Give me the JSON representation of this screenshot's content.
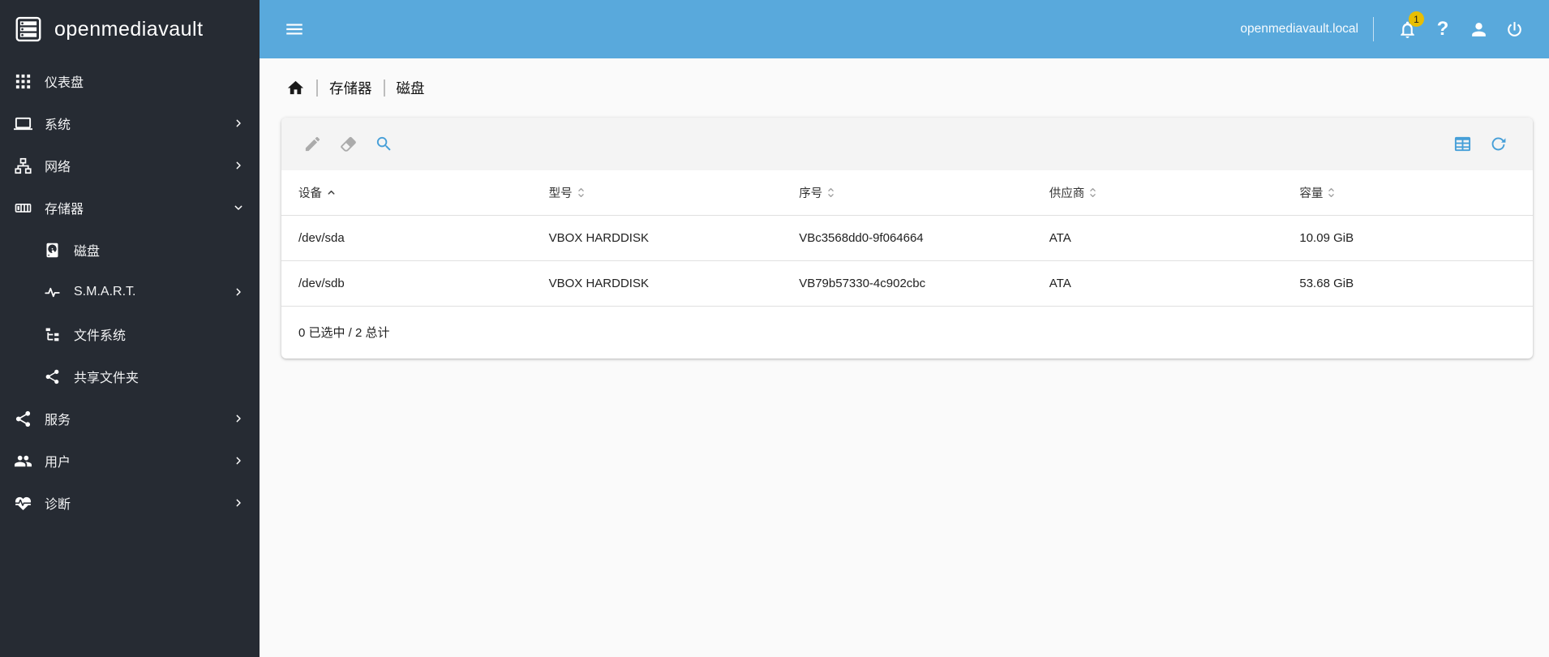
{
  "app": {
    "logo_text": "openmediavault"
  },
  "colors": {
    "header_blue": "#59A9DC",
    "sidebar_bg": "#262B33",
    "accent": "#469FD8",
    "page_bg": "#FAFAFA",
    "card_bg": "#FFFFFF",
    "toolbar_bg": "#F4F4F4",
    "border": "#E0E0E0",
    "text_dark": "#212121",
    "badge_yellow": "#E8BE03",
    "icon_disabled": "#ABABAB"
  },
  "topbar": {
    "hostname": "openmediavault.local",
    "notification_count": "1"
  },
  "sidebar": {
    "items": [
      {
        "id": "dashboard",
        "label": "仪表盘",
        "icon": "dashboard",
        "chevron": null,
        "indent": false
      },
      {
        "id": "system",
        "label": "系统",
        "icon": "laptop",
        "chevron": "right",
        "indent": false
      },
      {
        "id": "network",
        "label": "网络",
        "icon": "lan",
        "chevron": "right",
        "indent": false
      },
      {
        "id": "storage",
        "label": "存储器",
        "icon": "storage",
        "chevron": "down",
        "indent": false
      },
      {
        "id": "disks",
        "label": "磁盘",
        "icon": "harddisk",
        "chevron": null,
        "indent": true
      },
      {
        "id": "smart",
        "label": "S.M.A.R.T.",
        "icon": "pulse",
        "chevron": "right",
        "indent": true
      },
      {
        "id": "filesystems",
        "label": "文件系统",
        "icon": "file-tree",
        "chevron": null,
        "indent": true
      },
      {
        "id": "sharedfolders",
        "label": "共享文件夹",
        "icon": "share-variant",
        "chevron": null,
        "indent": true
      },
      {
        "id": "services",
        "label": "服务",
        "icon": "share-variant",
        "chevron": "right",
        "indent": false
      },
      {
        "id": "users",
        "label": "用户",
        "icon": "account-multiple",
        "chevron": "right",
        "indent": false
      },
      {
        "id": "diagnostics",
        "label": "诊断",
        "icon": "heart-pulse",
        "chevron": "right",
        "indent": false
      }
    ]
  },
  "breadcrumb": {
    "items": [
      "存储器",
      "磁盘"
    ]
  },
  "toolbar": {
    "left": [
      {
        "id": "edit",
        "icon": "pencil",
        "enabled": false
      },
      {
        "id": "wipe",
        "icon": "eraser",
        "enabled": false
      },
      {
        "id": "search",
        "icon": "magnify",
        "enabled": true
      }
    ],
    "right": [
      {
        "id": "columns",
        "icon": "table",
        "enabled": true
      },
      {
        "id": "reload",
        "icon": "reload",
        "enabled": true
      }
    ]
  },
  "table": {
    "columns": [
      {
        "label": "设备",
        "sort": "asc"
      },
      {
        "label": "型号",
        "sort": "both"
      },
      {
        "label": "序号",
        "sort": "both"
      },
      {
        "label": "供应商",
        "sort": "both"
      },
      {
        "label": "容量",
        "sort": "both"
      }
    ],
    "rows": [
      [
        "/dev/sda",
        "VBOX HARDDISK",
        "VBc3568dd0-9f064664",
        "ATA",
        "10.09 GiB"
      ],
      [
        "/dev/sdb",
        "VBOX HARDDISK",
        "VB79b57330-4c902cbc",
        "ATA",
        "53.68 GiB"
      ]
    ],
    "footer": "0 已选中 / 2 总计"
  }
}
